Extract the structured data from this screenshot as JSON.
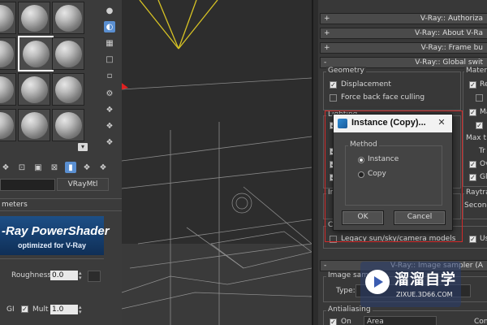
{
  "material_editor": {
    "field_roughness_label": "Roughness",
    "field_roughness_value": "0.0",
    "gi_label": "GI",
    "mult_label": "Mult",
    "mult_value": "1.0",
    "material_type": "VRayMtl",
    "params_header": "meters",
    "banner_title": "-Ray PowerShader",
    "banner_subtitle": "optimized for V-Ray"
  },
  "vray_panel": {
    "rollouts": [
      {
        "sign": "+",
        "label": "V-Ray:: Authoriza"
      },
      {
        "sign": "+",
        "label": "V-Ray:: About V-Ra"
      },
      {
        "sign": "+",
        "label": "V-Ray:: Frame bu"
      },
      {
        "sign": "-",
        "label": "V-Ray:: Global swit"
      }
    ],
    "geometry_label": "Geometry",
    "materials_label": "Materia",
    "displacement": "Displacement",
    "force_back_face": "Force back face culling",
    "lighting_label": "Lighting",
    "max_t": "Max t",
    "tr": "Tr",
    "ov": "Ov",
    "gl": "Gl",
    "re": "Re",
    "ma": "Ma",
    "ir": "Ir",
    "raytr": "Raytra",
    "second": "Seconda",
    "co": "Co",
    "legacy": "Legacy sun/sky/camera models",
    "us": "Us",
    "image_sampler_rollout": "V-Ray:: Image sampler (A",
    "image_samp": "Image samp",
    "type_label": "Type:",
    "antialiasing": "Antialiasing",
    "on_label": "On",
    "area_value": "Area",
    "con": "Con"
  },
  "dialog": {
    "title": "Instance (Copy)...",
    "close": "✕",
    "method_label": "Method",
    "options": [
      "Instance",
      "Copy"
    ],
    "selected_index": 0,
    "ok": "OK",
    "cancel": "Cancel"
  },
  "watermark": {
    "name": "溜溜自学",
    "url": "ZIXUE.3D66.COM"
  }
}
